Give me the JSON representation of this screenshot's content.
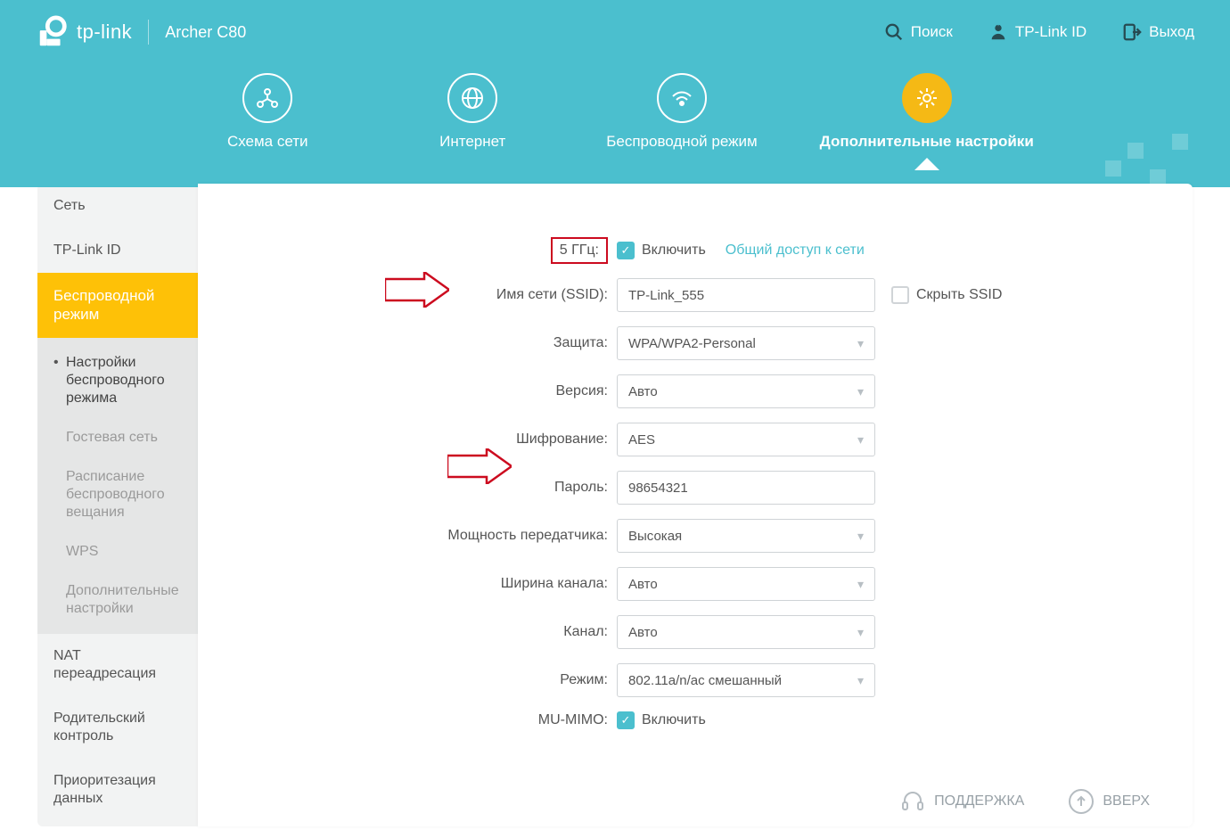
{
  "header": {
    "brand": "tp-link",
    "model": "Archer C80",
    "links": {
      "search": "Поиск",
      "tplink_id": "TP-Link ID",
      "logout": "Выход"
    }
  },
  "tabs": {
    "0": {
      "label": "Схема сети"
    },
    "1": {
      "label": "Интернет"
    },
    "2": {
      "label": "Беспроводной режим"
    },
    "3": {
      "label": "Дополнительные настройки"
    }
  },
  "sidebar": {
    "items": {
      "0": {
        "label": "Сеть"
      },
      "1": {
        "label": "TP-Link ID"
      },
      "2": {
        "label": "Беспроводной режим"
      },
      "3": {
        "label": "NAT переадресация"
      },
      "4": {
        "label": "Родительский контроль"
      },
      "5": {
        "label": "Приоритезация данных"
      }
    },
    "sub": {
      "0": {
        "label": "Настройки беспроводного режима"
      },
      "1": {
        "label": "Гостевая сеть"
      },
      "2": {
        "label": "Расписание беспроводного вещания"
      },
      "3": {
        "label": "WPS"
      },
      "4": {
        "label": "Дополнительные настройки"
      }
    }
  },
  "form": {
    "band_label": "5 ГГц:",
    "enable_label": "Включить",
    "share_link": "Общий доступ к сети",
    "ssid_label": "Имя сети (SSID):",
    "ssid_value": "TP-Link_555",
    "hide_ssid_label": "Скрыть SSID",
    "security_label": "Защита:",
    "security_value": "WPA/WPA2-Personal",
    "version_label": "Версия:",
    "version_value": "Авто",
    "encryption_label": "Шифрование:",
    "encryption_value": "AES",
    "password_label": "Пароль:",
    "password_value": "98654321",
    "txpower_label": "Мощность передатчика:",
    "txpower_value": "Высокая",
    "chanwidth_label": "Ширина канала:",
    "chanwidth_value": "Авто",
    "channel_label": "Канал:",
    "channel_value": "Авто",
    "mode_label": "Режим:",
    "mode_value": "802.11a/n/ac смешанный",
    "mumimo_label": "MU-MIMO:",
    "mumimo_enable": "Включить"
  },
  "footer": {
    "support": "ПОДДЕРЖКА",
    "top": "ВВЕРХ"
  }
}
